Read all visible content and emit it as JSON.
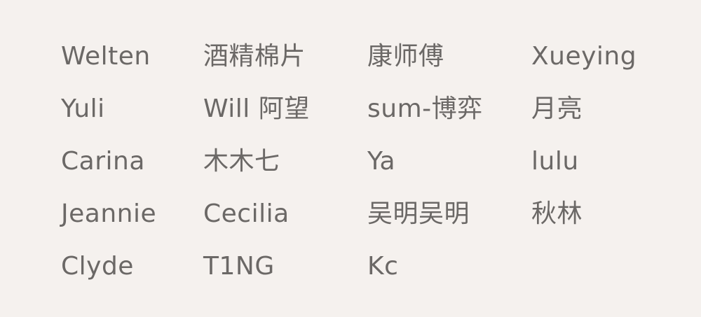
{
  "names": {
    "col1": [
      "Welten",
      "Yuli",
      "Carina",
      "Jeannie",
      "Clyde"
    ],
    "col2": [
      "酒精棉片",
      "Will 阿望",
      "木木七",
      "Cecilia",
      "T1NG"
    ],
    "col3": [
      "康师傅",
      "sum-博弈",
      "Ya",
      "吴明吴明",
      "Kc"
    ],
    "col4": [
      "Xueying",
      "月亮",
      "lulu",
      "秋林"
    ]
  }
}
